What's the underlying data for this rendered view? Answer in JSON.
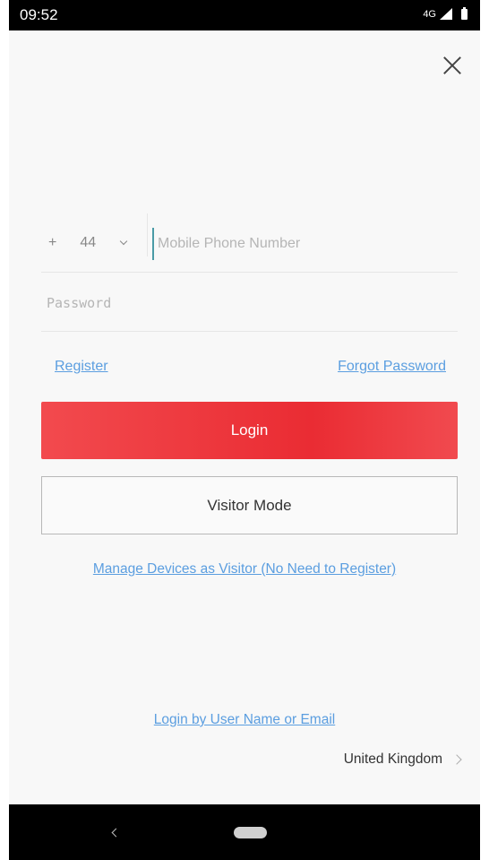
{
  "status_bar": {
    "time": "09:52",
    "network": "4G"
  },
  "login_form": {
    "country_code_plus": "+",
    "country_code": "44",
    "phone_placeholder": "Mobile Phone Number",
    "password_placeholder": "Password",
    "register_label": "Register",
    "forgot_password_label": "Forgot Password",
    "login_label": "Login",
    "visitor_mode_label": "Visitor Mode",
    "manage_devices_label": "Manage Devices as Visitor (No Need to Register)",
    "login_by_label": "Login by User Name or Email",
    "region": "United Kingdom"
  },
  "icons": {
    "close": "close-icon",
    "chevron_down": "chevron-down-icon",
    "chevron_right": "chevron-right-icon",
    "back": "back-icon",
    "home": "home-icon"
  },
  "colors": {
    "primary": "#ea2c33",
    "link": "#5b9ee0",
    "cursor": "#4a9ba6"
  }
}
